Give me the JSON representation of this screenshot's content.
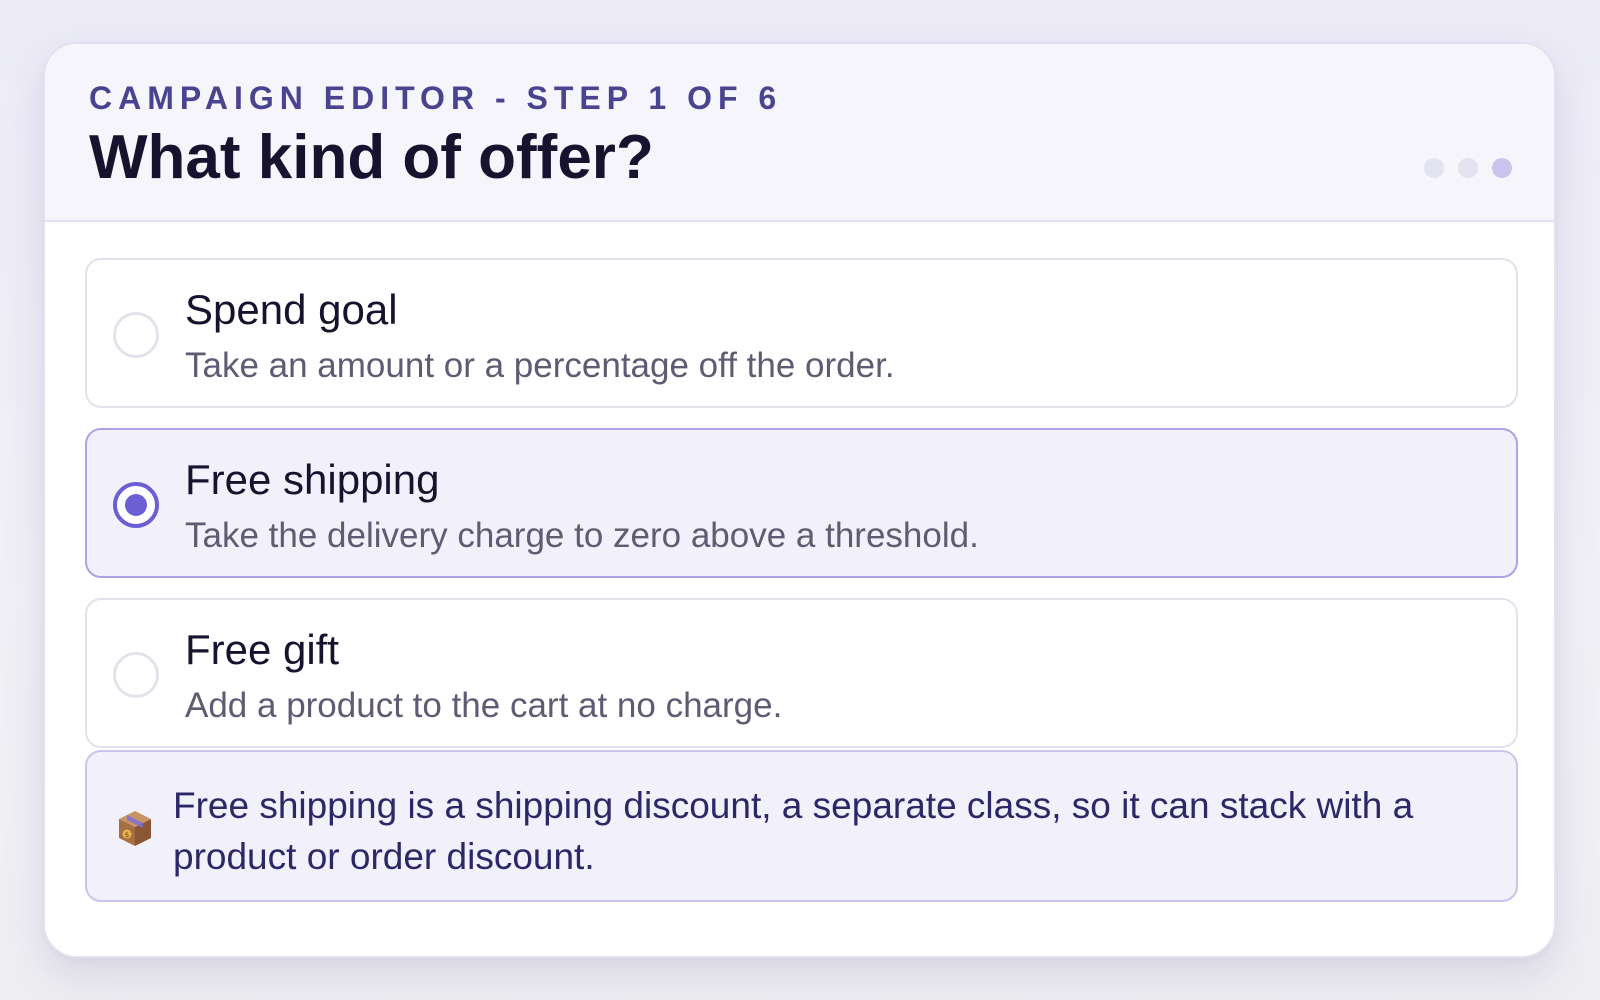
{
  "header": {
    "eyebrow": "CAMPAIGN EDITOR - STEP 1 OF 6",
    "title": "What kind of offer?"
  },
  "options": [
    {
      "title": "Spend goal",
      "description": "Take an amount or a percentage off the order.",
      "selected": false
    },
    {
      "title": "Free shipping",
      "description": "Take the delivery charge to zero above a threshold.",
      "selected": true
    },
    {
      "title": "Free gift",
      "description": "Add a product to the cart at no charge.",
      "selected": false
    }
  ],
  "note": {
    "icon": "package-icon",
    "text": "Free shipping is a shipping discount, a separate class, so it can stack with a product or order discount."
  },
  "colors": {
    "accent": "#6b5fd3",
    "heading": "#16132e",
    "eyebrow": "#4a4490",
    "note_text": "#2c2766"
  }
}
